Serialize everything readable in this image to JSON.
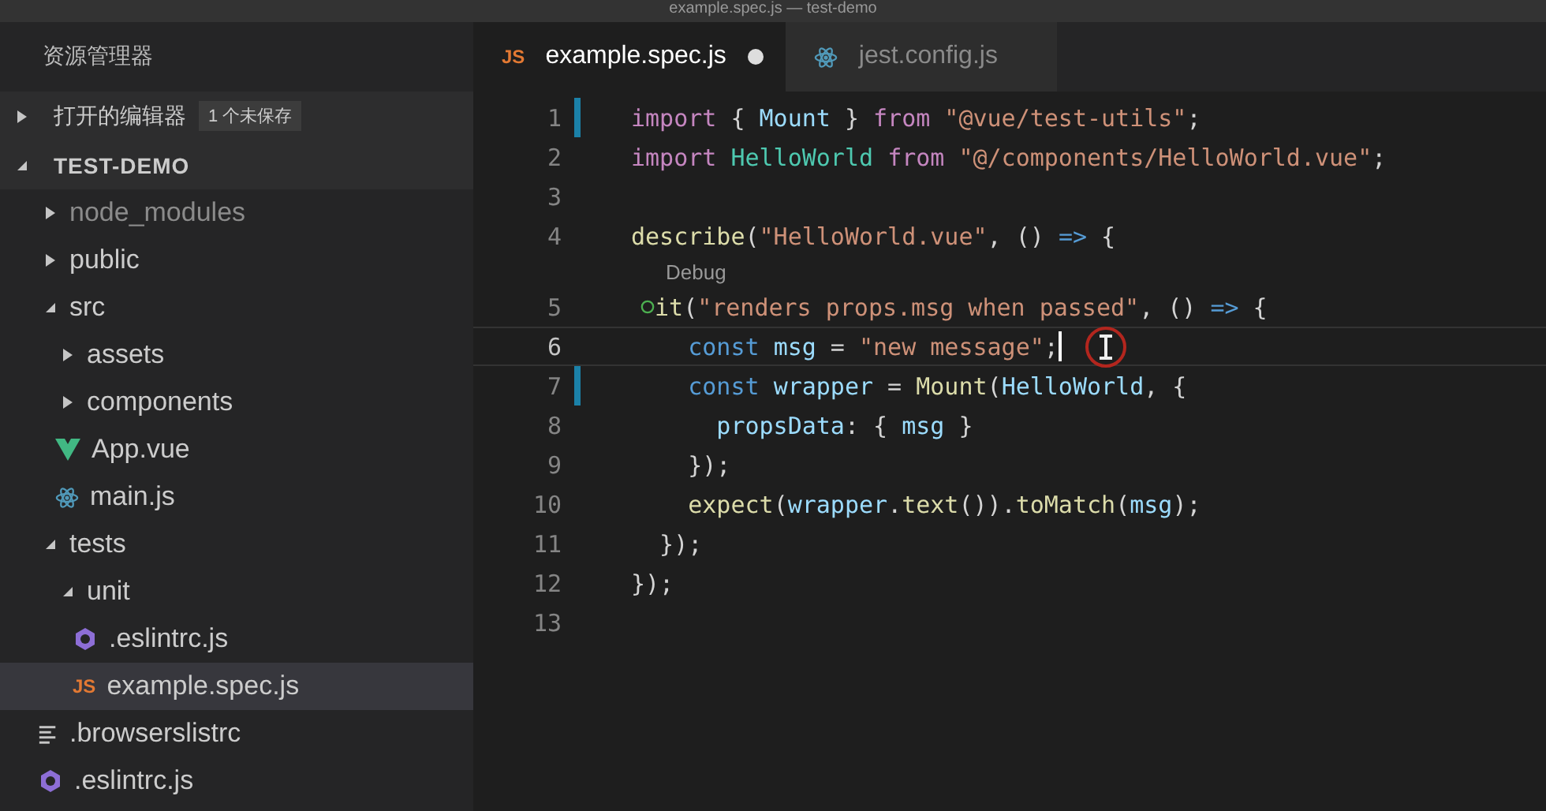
{
  "window": {
    "title": "example.spec.js — test-demo"
  },
  "sidebar": {
    "title": "资源管理器",
    "sections": [
      {
        "label": "打开的编辑器",
        "expanded": false,
        "badge": "1 个未保存"
      },
      {
        "label": "TEST-DEMO",
        "expanded": true
      }
    ],
    "tree": [
      {
        "name": "node_modules",
        "kind": "folder",
        "expanded": false,
        "ignored": true,
        "selected": false
      },
      {
        "name": "public",
        "kind": "folder",
        "expanded": false,
        "ignored": false,
        "selected": false
      },
      {
        "name": "src",
        "kind": "folder",
        "expanded": true,
        "ignored": false,
        "selected": false,
        "children": [
          {
            "name": "assets",
            "kind": "folder",
            "expanded": false,
            "ignored": false,
            "selected": false
          },
          {
            "name": "components",
            "kind": "folder",
            "expanded": false,
            "ignored": false,
            "selected": false
          },
          {
            "name": "App.vue",
            "kind": "vue",
            "ignored": false,
            "selected": false
          },
          {
            "name": "main.js",
            "kind": "atom",
            "ignored": false,
            "selected": false
          }
        ]
      },
      {
        "name": "tests",
        "kind": "folder",
        "expanded": true,
        "ignored": false,
        "selected": false,
        "children": [
          {
            "name": "unit",
            "kind": "folder",
            "expanded": true,
            "ignored": false,
            "selected": false,
            "children": [
              {
                "name": ".eslintrc.js",
                "kind": "eslint",
                "ignored": false,
                "selected": false
              },
              {
                "name": "example.spec.js",
                "kind": "js",
                "icon_label": "JS",
                "ignored": false,
                "selected": true
              }
            ]
          }
        ]
      },
      {
        "name": ".browserslistrc",
        "kind": "text",
        "ignored": false,
        "selected": false
      },
      {
        "name": ".eslintrc.js",
        "kind": "eslint",
        "ignored": false,
        "selected": false
      }
    ]
  },
  "tabs": [
    {
      "label": "example.spec.js",
      "kind": "js",
      "icon_label": "JS",
      "selected": true,
      "modified": true
    },
    {
      "label": "jest.config.js",
      "kind": "atom",
      "selected": false,
      "modified": false
    }
  ],
  "editor": {
    "lines": [
      {
        "number": "1",
        "modified": true,
        "current": false,
        "tokens": [
          {
            "s": "import",
            "color": "#c586c0"
          },
          {
            "s": " { ",
            "color": "#d4d4d4"
          },
          {
            "s": "Mount",
            "color": "#9cdcfe"
          },
          {
            "s": " } ",
            "color": "#d4d4d4"
          },
          {
            "s": "from",
            "color": "#c586c0"
          },
          {
            "s": " \"@vue/test-utils\"",
            "color": "#ce9178"
          },
          {
            "s": ";",
            "color": "#d4d4d4"
          }
        ]
      },
      {
        "number": "2",
        "modified": false,
        "current": false,
        "tokens": [
          {
            "s": "import ",
            "color": "#c586c0"
          },
          {
            "s": "HelloWorld ",
            "color": "#4ec9b0"
          },
          {
            "s": "from ",
            "color": "#c586c0"
          },
          {
            "s": "\"@/components/HelloWorld.vue\"",
            "color": "#ce9178"
          },
          {
            "s": ";",
            "color": "#d4d4d4"
          }
        ]
      },
      {
        "number": "3",
        "modified": false,
        "current": false
      },
      {
        "number": "4",
        "modified": false,
        "current": false,
        "tokens": [
          {
            "s": "describe",
            "color": "#dcdcaa"
          },
          {
            "s": "(",
            "color": "#d4d4d4"
          },
          {
            "s": "\"HelloWorld.vue\"",
            "color": "#ce9178"
          },
          {
            "s": ", () ",
            "color": "#d4d4d4"
          },
          {
            "s": "=>",
            "color": "#569cd6"
          },
          {
            "s": " {",
            "color": "#d4d4d4"
          }
        ]
      },
      {
        "number": "5",
        "modified": false,
        "current": false,
        "codelens": "Debug",
        "status": true,
        "tokens": [
          {
            "s": "it",
            "color": "#dcdcaa"
          },
          {
            "s": "(",
            "color": "#d4d4d4"
          },
          {
            "s": "\"renders props.msg when passed\"",
            "color": "#ce9178"
          },
          {
            "s": ", () ",
            "color": "#d4d4d4"
          },
          {
            "s": "=>",
            "color": "#569cd6"
          },
          {
            "s": " {",
            "color": "#d4d4d4"
          }
        ]
      },
      {
        "number": "6",
        "modified": false,
        "current": true,
        "status": false,
        "tokens": [
          {
            "s": "    const ",
            "color": "#569cd6"
          },
          {
            "s": "msg",
            "color": "#9cdcfe"
          },
          {
            "s": " = ",
            "color": "#d4d4d4"
          },
          {
            "s": "\"new message\"",
            "color": "#ce9178"
          },
          {
            "s": ";",
            "color": "#d4d4d4"
          }
        ]
      },
      {
        "number": "7",
        "modified": true,
        "current": false,
        "status": false,
        "tokens": [
          {
            "s": "    const ",
            "color": "#569cd6"
          },
          {
            "s": "wrapper",
            "color": "#9cdcfe"
          },
          {
            "s": " = ",
            "color": "#d4d4d4"
          },
          {
            "s": "Mount",
            "color": "#dcdcaa"
          },
          {
            "s": "(",
            "color": "#d4d4d4"
          },
          {
            "s": "HelloWorld",
            "color": "#9cdcfe"
          },
          {
            "s": ", {",
            "color": "#d4d4d4"
          }
        ]
      },
      {
        "number": "8",
        "modified": false,
        "current": false,
        "status": false,
        "tokens": [
          {
            "s": "      propsData",
            "color": "#9cdcfe"
          },
          {
            "s": ": { ",
            "color": "#d4d4d4"
          },
          {
            "s": "msg",
            "color": "#9cdcfe"
          },
          {
            "s": " }",
            "color": "#d4d4d4"
          }
        ]
      },
      {
        "number": "9",
        "modified": false,
        "current": false,
        "status": false,
        "tokens": [
          {
            "s": "    });",
            "color": "#d4d4d4"
          }
        ]
      },
      {
        "number": "10",
        "modified": false,
        "current": false,
        "status": false,
        "tokens": [
          {
            "s": "    expect",
            "color": "#dcdcaa"
          },
          {
            "s": "(",
            "color": "#d4d4d4"
          },
          {
            "s": "wrapper",
            "color": "#9cdcfe"
          },
          {
            "s": ".",
            "color": "#d4d4d4"
          },
          {
            "s": "text",
            "color": "#dcdcaa"
          },
          {
            "s": "()).",
            "color": "#d4d4d4"
          },
          {
            "s": "toMatch",
            "color": "#dcdcaa"
          },
          {
            "s": "(",
            "color": "#d4d4d4"
          },
          {
            "s": "msg",
            "color": "#9cdcfe"
          },
          {
            "s": ");",
            "color": "#d4d4d4"
          }
        ]
      },
      {
        "number": "11",
        "modified": false,
        "current": false,
        "status": false,
        "tokens": [
          {
            "s": "  });",
            "color": "#d4d4d4"
          }
        ]
      },
      {
        "number": "12",
        "modified": false,
        "current": false,
        "tokens": [
          {
            "s": "});",
            "color": "#d4d4d4"
          }
        ]
      },
      {
        "number": "13",
        "modified": false,
        "current": false
      }
    ]
  }
}
